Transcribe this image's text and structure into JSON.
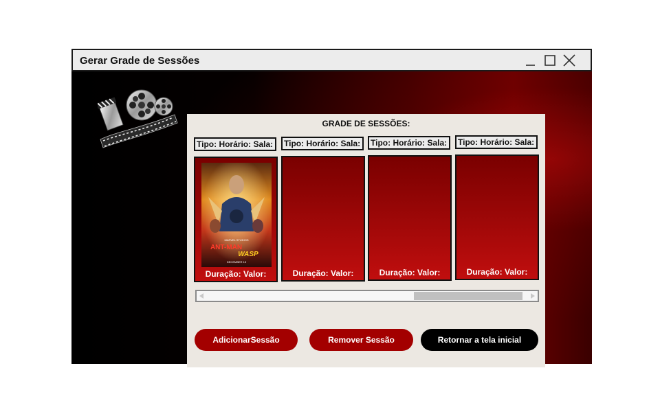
{
  "window": {
    "title": "Gerar Grade de Sessões",
    "controls": [
      "minimize-icon",
      "maximize-icon",
      "close-icon"
    ]
  },
  "panel": {
    "title": "GRADE DE SESSÕES:"
  },
  "sessions": [
    {
      "info": "Tipo:  Horário:  Sala:",
      "footer": "Duração:  Valor:",
      "has_poster": true,
      "poster_text": {
        "top": "MARVEL STUDIOS",
        "title_a": "ANT-MAN",
        "title_b": "WASP",
        "date": "DECEMBER 13"
      }
    },
    {
      "info": "Tipo:  Horário:  Sala:",
      "footer": "Duração:  Valor:",
      "has_poster": false
    },
    {
      "info": "Tipo:  Horário:  Sala:",
      "footer": "Duração:  Valor:",
      "has_poster": false
    },
    {
      "info": "Tipo:  Horário:  Sala:",
      "footer": "Duração:  Valor:",
      "has_poster": false
    }
  ],
  "scrollbar": {
    "position": 0.63
  },
  "buttons": {
    "add": "AdicionarSessão",
    "remove": "Remover Sessão",
    "back": "Retornar a tela inicial"
  },
  "colors": {
    "accent_red": "#a30000",
    "card_gradient_top": "#7a0000",
    "card_gradient_bottom": "#c00e0e",
    "panel_bg": "#ece8e2"
  },
  "icons": [
    "film-reel-icon",
    "clapperboard-icon",
    "film-strip-icon"
  ]
}
